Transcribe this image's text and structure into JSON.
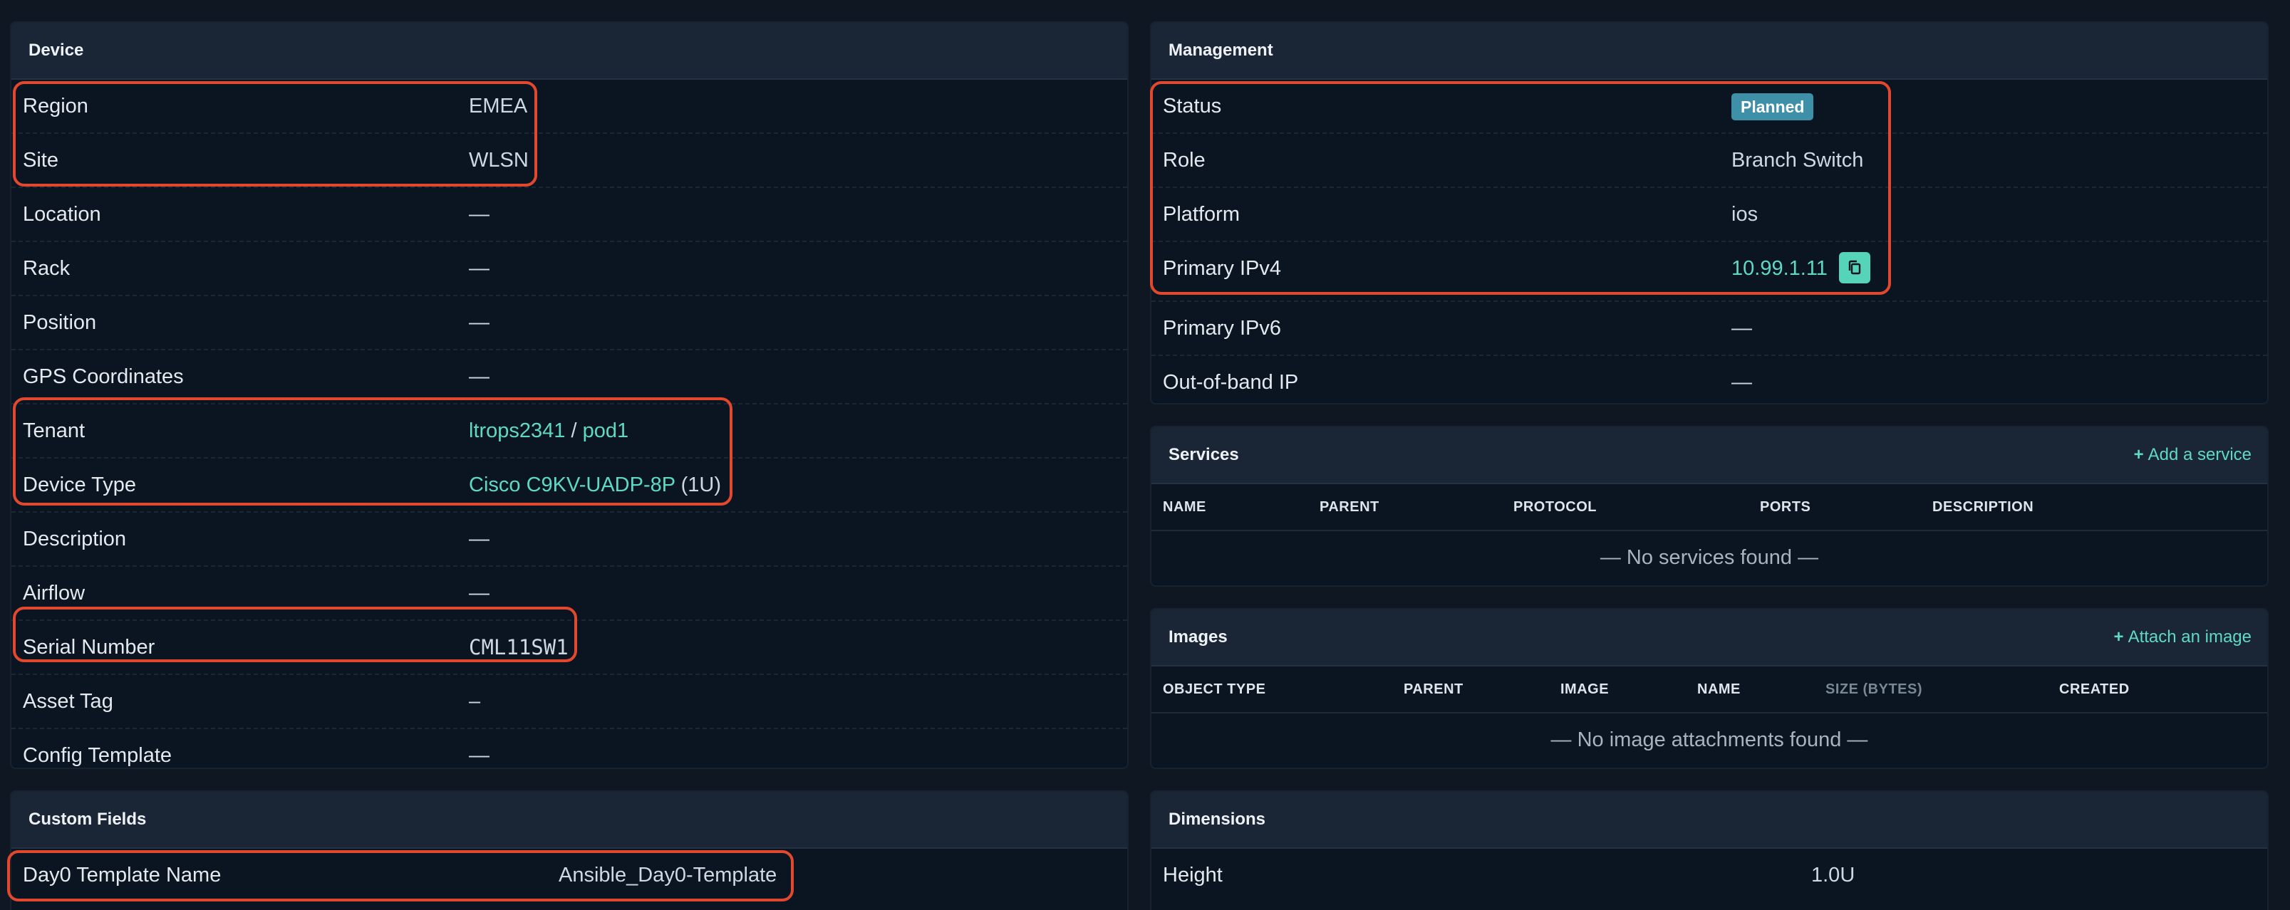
{
  "device": {
    "header": "Device",
    "rows": [
      {
        "label": "Region",
        "value": "EMEA"
      },
      {
        "label": "Site",
        "value": "WLSN"
      },
      {
        "label": "Location",
        "value": "—"
      },
      {
        "label": "Rack",
        "value": "—"
      },
      {
        "label": "Position",
        "value": "—"
      },
      {
        "label": "GPS Coordinates",
        "value": "—"
      },
      {
        "label": "Tenant",
        "value_group": "ltrops2341",
        "separator": "/",
        "value_tenant": "pod1"
      },
      {
        "label": "Device Type",
        "value": "Cisco C9KV-UADP-8P",
        "suffix": "(1U)"
      },
      {
        "label": "Description",
        "value": "—"
      },
      {
        "label": "Airflow",
        "value": "—"
      },
      {
        "label": "Serial Number",
        "value": "CML11SW1"
      },
      {
        "label": "Asset Tag",
        "value": "–"
      },
      {
        "label": "Config Template",
        "value": "—"
      }
    ]
  },
  "custom_fields": {
    "header": "Custom Fields",
    "rows": [
      {
        "label": "Day0 Template Name",
        "value": "Ansible_Day0-Template"
      }
    ]
  },
  "management": {
    "header": "Management",
    "rows": [
      {
        "label": "Status",
        "value": "Planned"
      },
      {
        "label": "Role",
        "value": "Branch Switch"
      },
      {
        "label": "Platform",
        "value": "ios"
      },
      {
        "label": "Primary IPv4",
        "value": "10.99.1.11",
        "copy_icon": "copy-icon"
      },
      {
        "label": "Primary IPv6",
        "value": "—"
      },
      {
        "label": "Out-of-band IP",
        "value": "—"
      }
    ]
  },
  "services": {
    "header": "Services",
    "add_label": "Add a service",
    "columns": [
      "NAME",
      "PARENT",
      "PROTOCOL",
      "PORTS",
      "DESCRIPTION"
    ],
    "empty": "— No services found —"
  },
  "images": {
    "header": "Images",
    "add_label": "Attach an image",
    "columns": [
      "OBJECT TYPE",
      "PARENT",
      "IMAGE",
      "NAME",
      "SIZE (BYTES)",
      "CREATED"
    ],
    "empty": "— No image attachments found —"
  },
  "dimensions": {
    "header": "Dimensions",
    "rows": [
      {
        "label": "Height",
        "value": "1.0U"
      }
    ]
  },
  "colors": {
    "link": "#5fd9c4",
    "badge": "#3e90a8",
    "highlight": "#e2482d"
  }
}
